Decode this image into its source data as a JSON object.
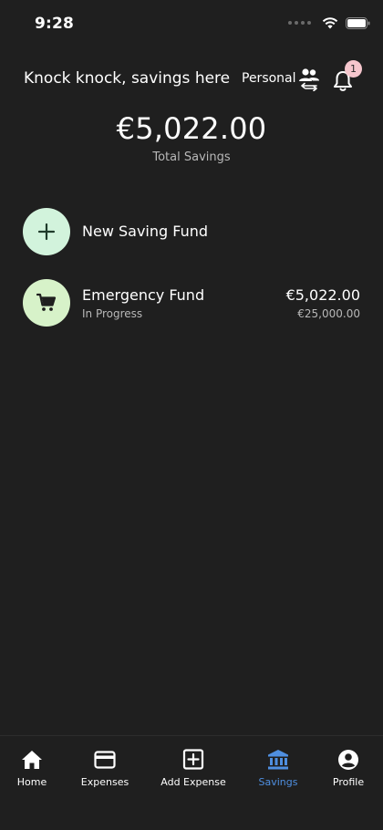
{
  "status_bar": {
    "time": "9:28"
  },
  "header": {
    "greeting": "Knock knock, savings here",
    "workspace": "Personal",
    "notification_count": "1"
  },
  "summary": {
    "total_amount": "€5,022.00",
    "total_label": "Total Savings"
  },
  "actions": {
    "new_fund_label": "New Saving Fund"
  },
  "funds": [
    {
      "name": "Emergency Fund",
      "status": "In Progress",
      "amount": "€5,022.00",
      "goal": "€25,000.00",
      "icon": "cart-icon"
    }
  ],
  "nav": {
    "items": [
      {
        "label": "Home",
        "icon": "home-icon"
      },
      {
        "label": "Expenses",
        "icon": "card-icon"
      },
      {
        "label": "Add Expense",
        "icon": "plus-square-icon"
      },
      {
        "label": "Savings",
        "icon": "bank-icon",
        "active": true
      },
      {
        "label": "Profile",
        "icon": "profile-icon"
      }
    ]
  },
  "colors": {
    "background": "#1f1f1f",
    "accent": "#4f8fe0",
    "mint": "#d2f3dc",
    "badge": "#f6c6cd"
  }
}
